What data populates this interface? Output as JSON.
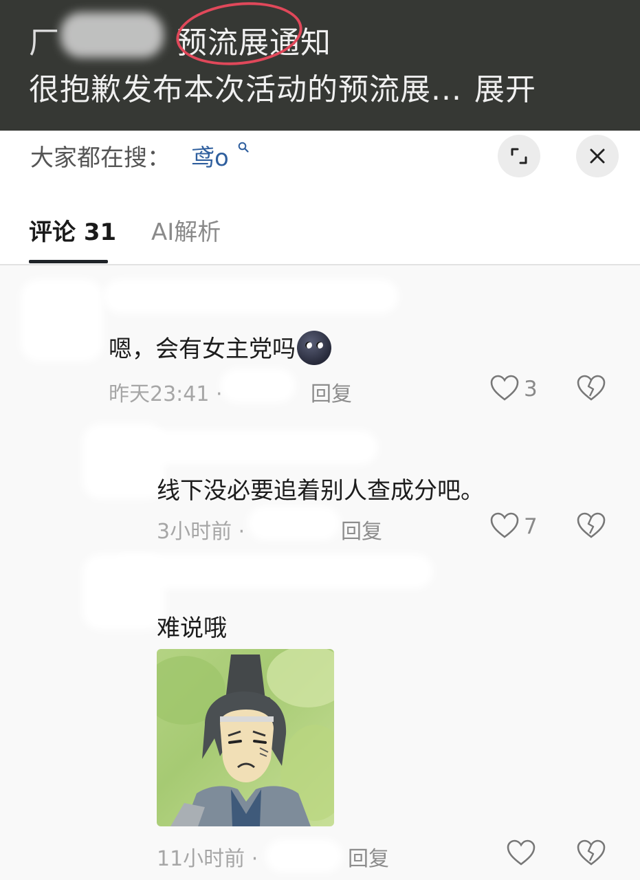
{
  "header": {
    "title_visible": "预流展通知",
    "subtitle": "很抱歉发布本次活动的预流展...",
    "expand_label": "展开"
  },
  "search": {
    "label": "大家都在搜：",
    "term": "鸢o"
  },
  "tabs": [
    {
      "label": "评论 31",
      "active": true
    },
    {
      "label": "AI解析",
      "active": false
    }
  ],
  "comments": [
    {
      "text": "嗯，会有女主党吗",
      "time": "昨天23:41 ·",
      "reply_label": "回复",
      "likes": "3",
      "emoji": "new-moon-face"
    },
    {
      "text": "线下没必要追着别人查成分吧。",
      "time": "3小时前 ·",
      "reply_label": "回复",
      "likes": "7"
    },
    {
      "text": "难说哦",
      "time": "11小时前 ·",
      "reply_label": "回复",
      "likes": "",
      "has_sticker": true
    }
  ],
  "colors": {
    "header_bg": "#363834",
    "link_blue": "#2f5f9e",
    "annotation_red": "#e0485a"
  }
}
